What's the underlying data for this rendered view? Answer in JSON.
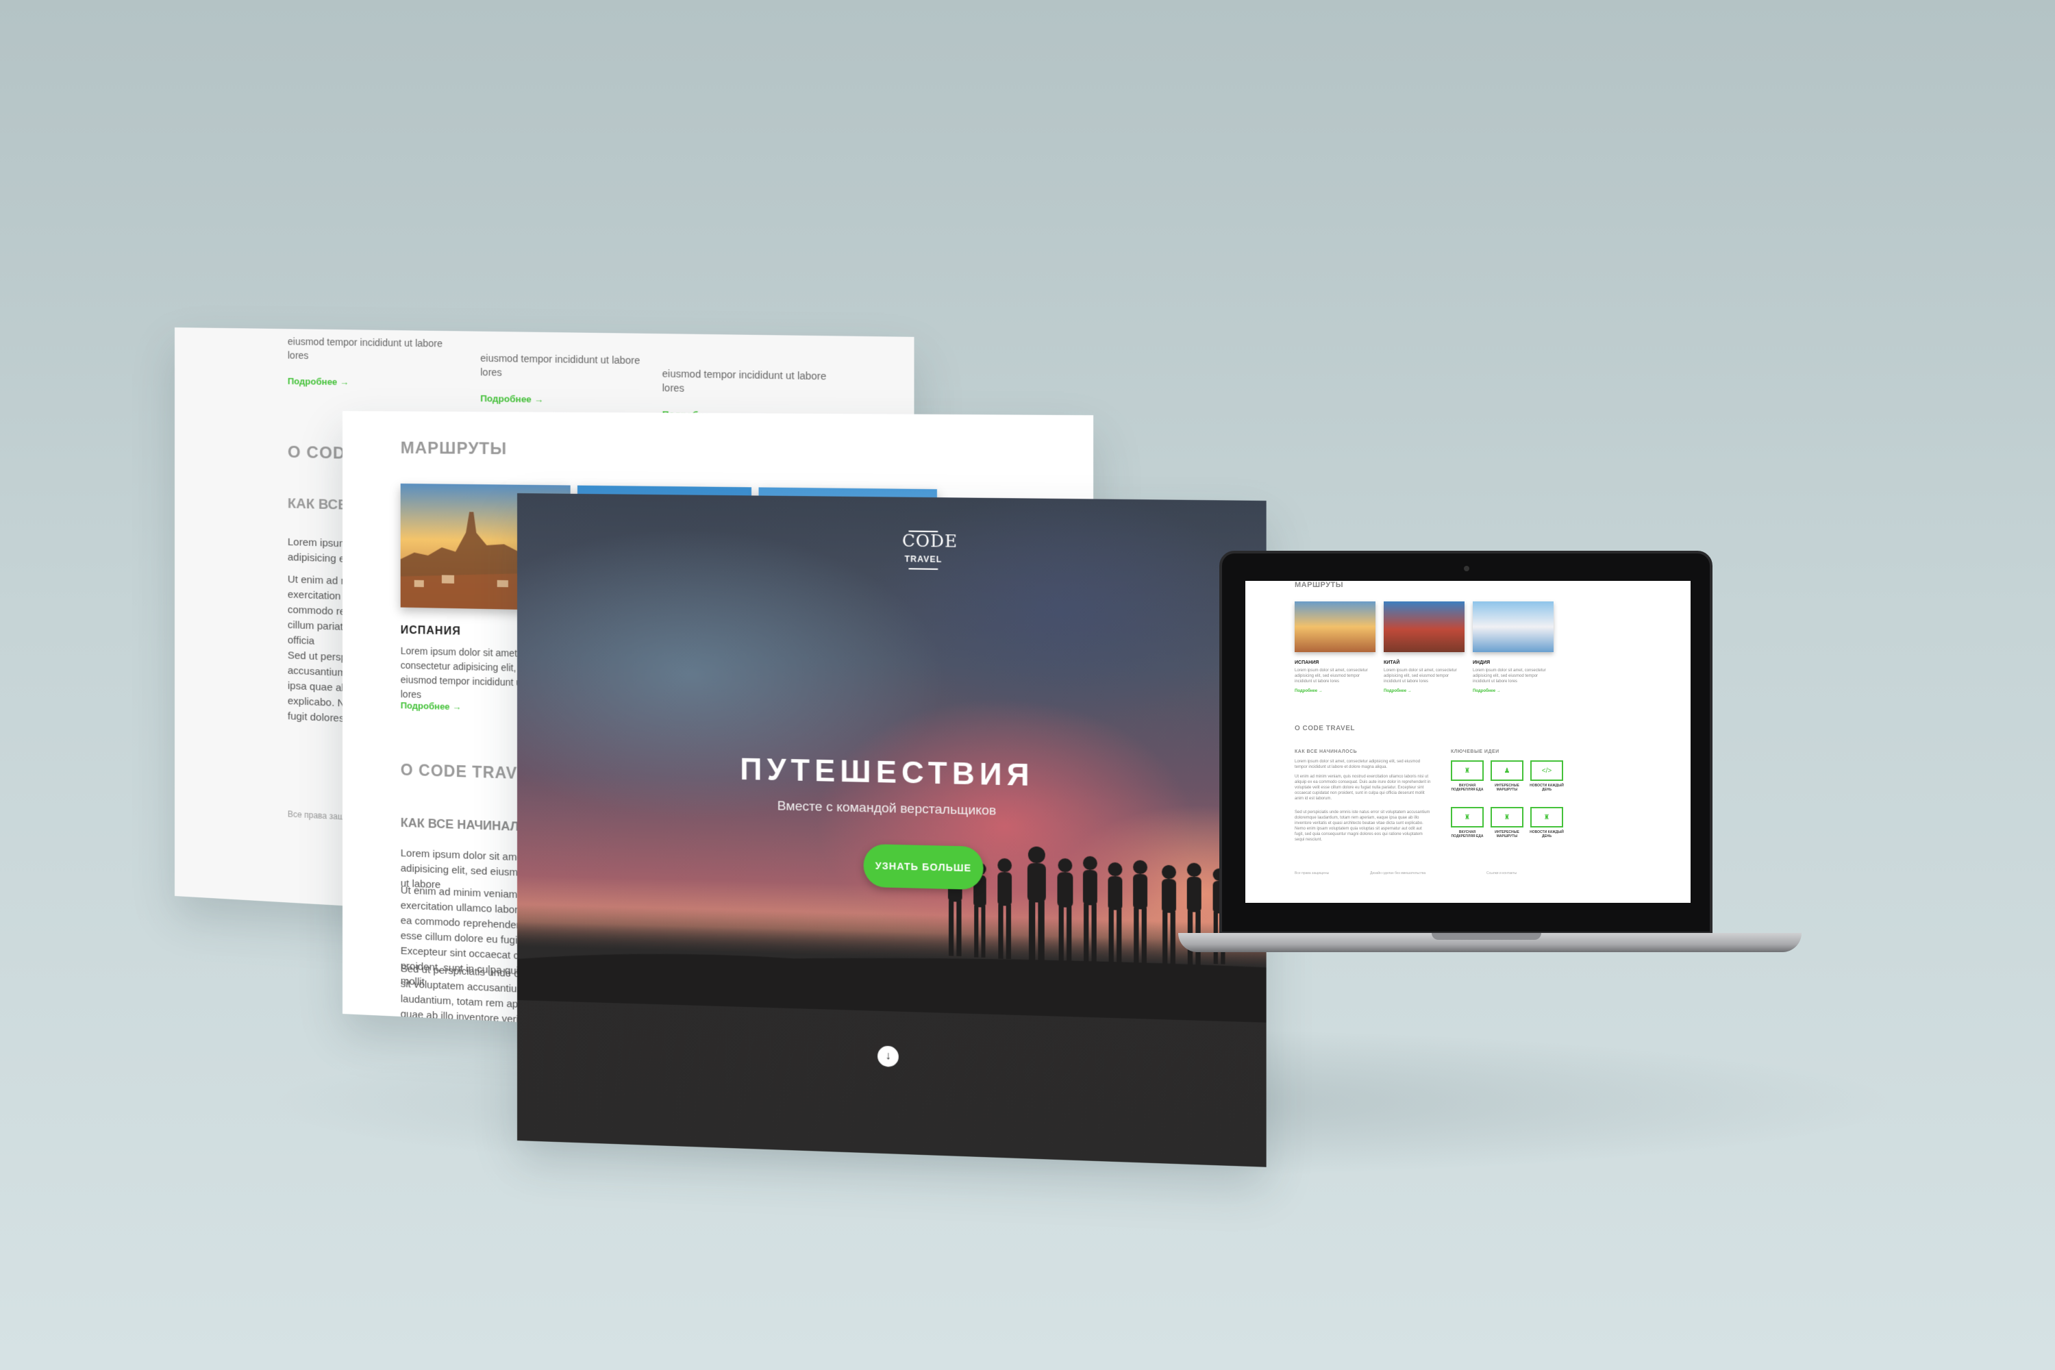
{
  "back_sheet": {
    "columns": [
      {
        "text": "eiusmod tempor incididunt ut labore lores",
        "more": "Подробнее →"
      },
      {
        "text": "eiusmod tempor incididunt ut labore lores",
        "more": "Подробнее →"
      },
      {
        "text": "eiusmod tempor incididunt ut labore lores",
        "more": "Подробнее →"
      }
    ],
    "about_heading": "О CODE",
    "how_heading": "КАК ВСЕ",
    "p1": "Lorem ipsum dolor sit amet, consectetur adipisicing elit, sed eiusmod tempor",
    "p2": "Ut enim ad minim veniam, quis nostrud exercitation ullamco laboris nisi ut aliquip ex ea commodo reprehenderit in voluptate velit esse cillum pariatur. Excepteur sint occaecat culpa qui officia",
    "p3": "Sed ut perspiciatis unde omnis iste natus accusantium doloremque laudantium, totam rem ipsa quae ab illo inventore veritatis dicta sunt explicabo. Nemo enim sit aspernatur aut odit aut fugit dolores eos",
    "footer": "Все права защищены"
  },
  "mid_sheet": {
    "routes_heading": "МАРШРУТЫ",
    "card_title": "ИСПАНИЯ",
    "card_text": "Lorem ipsum dolor sit amet, consectetur adipisicing elit, sed eiusmod tempor incididunt ut labore lores",
    "more": "Подробнее →",
    "about_heading": "О CODE TRAVEL",
    "how_heading": "КАК ВСЕ НАЧИНАЛОСЬ",
    "p1": "Lorem ipsum dolor sit amet, consectetur adipisicing elit, sed eiusmod tempor incididunt ut labore",
    "p2": "Ut enim ad minim veniam, quis nostrud exercitation ullamco laboris nisi ut aliquip ex ea commodo reprehenderit in voluptate velit esse cillum dolore eu fugiat nulla pariatur. Excepteur sint occaecat cupidatat non proident, sunt in culpa qui officia deserunt mollit",
    "p3": "Sed ut perspiciatis unde omnis iste natus error sit voluptatem accusantium doloremque laudantium, totam rem aperiam, eaque ipsa quae ab illo inventore veritatis et quasi architecto beatae vitae dicta sunt explicabo. Nemo enim ipsam voluptatem quia voluptas sit aspernatur aut odit aut fugit, sed quia"
  },
  "hero": {
    "logo_top": "CODE",
    "logo_bottom": "TRAVEL",
    "title": "ПУТЕШЕСТВИЯ",
    "subtitle": "Вместе с командой верстальщиков",
    "cta": "УЗНАТЬ БОЛЬШЕ",
    "scroll_icon": "↓"
  },
  "laptop": {
    "routes_heading": "МАРШРУТЫ",
    "cards": [
      {
        "title": "ИСПАНИЯ",
        "text": "Lorem ipsum dolor sit amet, consectetur adipisicing elit, sed eiusmod tempor incididunt ut labore lores",
        "more": "Подробнее →"
      },
      {
        "title": "КИТАЙ",
        "text": "Lorem ipsum dolor sit amet, consectetur adipisicing elit, sed eiusmod tempor incididunt ut labore lores",
        "more": "Подробнее →"
      },
      {
        "title": "ИНДИЯ",
        "text": "Lorem ipsum dolor sit amet, consectetur adipisicing elit, sed eiusmod tempor incididunt ut labore lores",
        "more": "Подробнее →"
      }
    ],
    "about_heading": "О CODE TRAVEL",
    "how_heading": "КАК ВСЕ НАЧИНАЛОСЬ",
    "p1": "Lorem ipsum dolor sit amet, consectetur adipisicing elit, sed eiusmod tempor incididunt ut labore et dolore magna aliqua.",
    "p2": "Ut enim ad minim veniam, quis nostrud exercitation ullamco laboris nisi ut aliquip ex ea commodo consequat. Duis aute irure dolor in reprehenderit in voluptate velit esse cillum dolore eu fugiat nulla pariatur. Excepteur sint occaecat cupidatat non proident, sunt in culpa qui officia deserunt mollit anim id est laborum.",
    "p3": "Sed ut perspiciatis unde omnis iste natus error sit voluptatem accusantium doloremque laudantium, totam rem aperiam, eaque ipsa quae ab illo inventore veritatis et quasi architecto beatae vitae dicta sunt explicabo. Nemo enim ipsam voluptatem quia voluptas sit aspernatur aut odit aut fugit, sed quia consequuntur magni dolores eos qui ratione voluptatem sequi nesciunt.",
    "key_ideas_heading": "КЛЮЧЕВЫЕ ИДЕИ",
    "ideas": [
      {
        "icon": "cup-icon",
        "glyph": "♜",
        "label": "ВКУСНАЯ ПОДКРЕПЛЯЯ ЕДА"
      },
      {
        "icon": "person-icon",
        "glyph": "♟",
        "label": "ИНТЕРЕСНЫЕ МАРШРУТЫ"
      },
      {
        "icon": "code-icon",
        "glyph": "</>",
        "label": "НОВОСТИ КАЖДЫЙ ДЕНЬ"
      },
      {
        "icon": "cup-icon",
        "glyph": "♜",
        "label": "ВКУСНАЯ ПОДКРЕПЛЯЯ ЕДА"
      },
      {
        "icon": "cup-icon",
        "glyph": "♜",
        "label": "ИНТЕРЕСНЫЕ МАРШРУТЫ"
      },
      {
        "icon": "cup-icon",
        "glyph": "♜",
        "label": "НОВОСТИ КАЖДЫЙ ДЕНЬ"
      }
    ],
    "footer": [
      "Все права защищены",
      "Дизайн сделан без вмешательства",
      "Ссылки и контакты"
    ]
  },
  "colors": {
    "accent": "#4cc93b",
    "background": "#c6d4d6",
    "hero_dark": "#2b2a2a"
  }
}
